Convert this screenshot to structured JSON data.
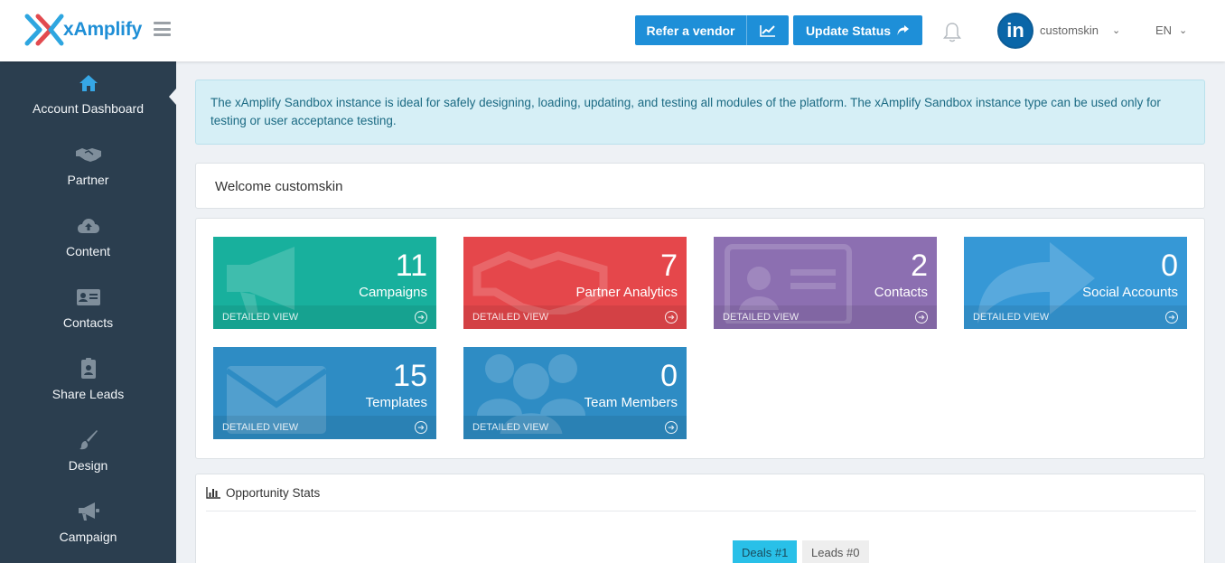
{
  "header": {
    "brand": "xAmplify",
    "refer_vendor_label": "Refer a vendor",
    "update_status_label": "Update Status",
    "user_name": "customskin",
    "avatar_text": "in",
    "language": "EN"
  },
  "sidebar": {
    "items": [
      {
        "label": "Account Dashboard",
        "icon": "home-icon"
      },
      {
        "label": "Partner",
        "icon": "handshake-icon"
      },
      {
        "label": "Content",
        "icon": "cloud-upload-icon"
      },
      {
        "label": "Contacts",
        "icon": "id-card-icon"
      },
      {
        "label": "Share Leads",
        "icon": "badge-icon"
      },
      {
        "label": "Design",
        "icon": "brush-icon"
      },
      {
        "label": "Campaign",
        "icon": "megaphone-icon"
      }
    ]
  },
  "alert": {
    "text": "The xAmplify Sandbox instance is ideal for safely designing, loading, updating, and testing all modules of the platform. The xAmplify Sandbox instance type can be used only for testing or user acceptance testing."
  },
  "welcome": {
    "text": "Welcome customskin"
  },
  "tiles": [
    {
      "count": "11",
      "label": "Campaigns",
      "footer": "DETAILED VIEW",
      "color": "#18b09d"
    },
    {
      "count": "7",
      "label": "Partner Analytics",
      "footer": "DETAILED VIEW",
      "color": "#e5474b"
    },
    {
      "count": "2",
      "label": "Contacts",
      "footer": "DETAILED VIEW",
      "color": "#8c6fb1"
    },
    {
      "count": "0",
      "label": "Social Accounts",
      "footer": "DETAILED VIEW",
      "color": "#3698d6"
    },
    {
      "count": "15",
      "label": "Templates",
      "footer": "DETAILED VIEW",
      "color": "#2e8cc4"
    },
    {
      "count": "0",
      "label": "Team Members",
      "footer": "DETAILED VIEW",
      "color": "#2e8cc4"
    }
  ],
  "opportunity": {
    "title": "Opportunity Stats",
    "tabs": [
      "Deals #1",
      "Leads #0"
    ]
  }
}
